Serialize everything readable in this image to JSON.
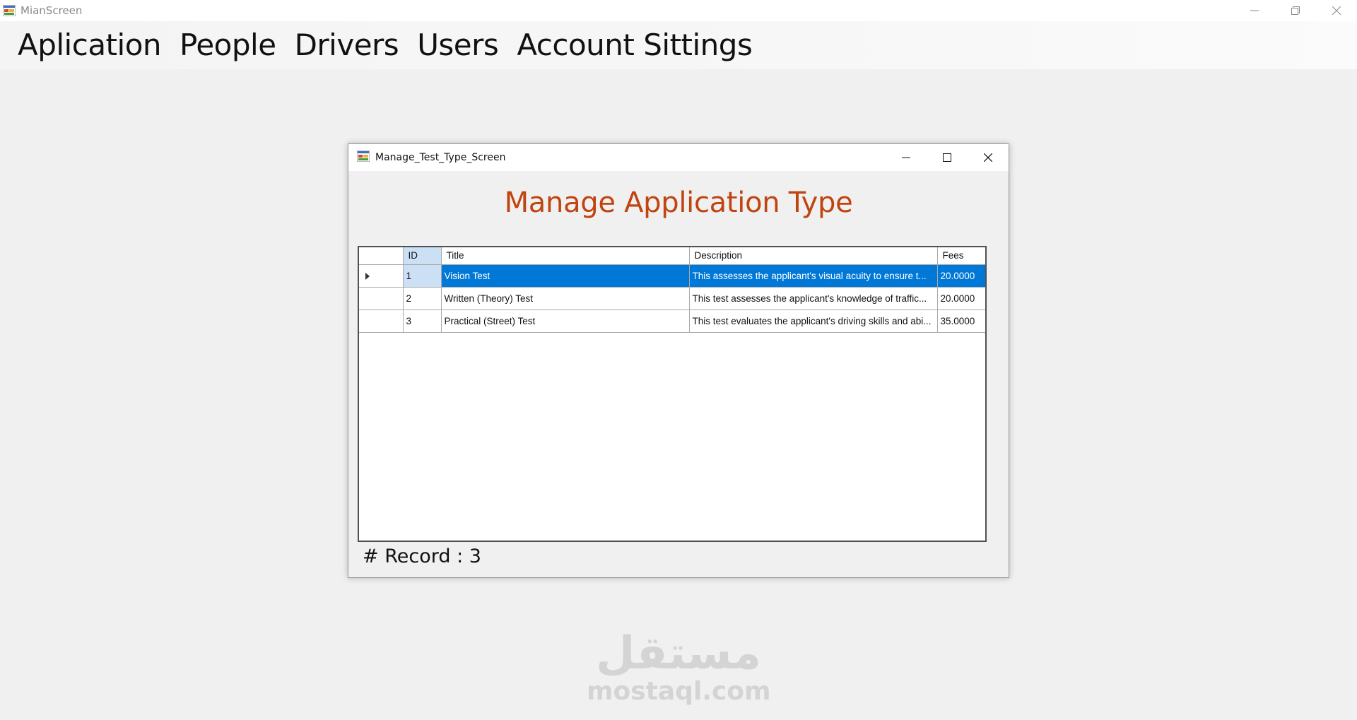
{
  "main_window": {
    "title": "MianScreen"
  },
  "menu": {
    "items": [
      "Aplication",
      "People",
      "Drivers",
      "Users",
      "Account Sittings"
    ]
  },
  "child_window": {
    "title": "Manage_Test_Type_Screen",
    "heading": "Manage Application Type",
    "grid": {
      "columns": [
        "ID",
        "Title",
        "Description",
        "Fees"
      ],
      "rows": [
        {
          "id": "1",
          "title": "Vision Test",
          "description": "This assesses the applicant's visual acuity to ensure t...",
          "fees": "20.0000"
        },
        {
          "id": "2",
          "title": "Written (Theory) Test",
          "description": "This test assesses the applicant's knowledge of traffic...",
          "fees": "20.0000"
        },
        {
          "id": "3",
          "title": "Practical (Street) Test",
          "description": "This test evaluates the applicant's driving skills and abi...",
          "fees": "35.0000"
        }
      ]
    },
    "record_label": "# Record :",
    "record_count": "3"
  },
  "watermark": {
    "arabic": "مستقل",
    "latin": "mostaql.com"
  },
  "colors": {
    "heading": "#c0440f",
    "selection": "#0078d7",
    "selected_column_header": "#cce0f5"
  }
}
